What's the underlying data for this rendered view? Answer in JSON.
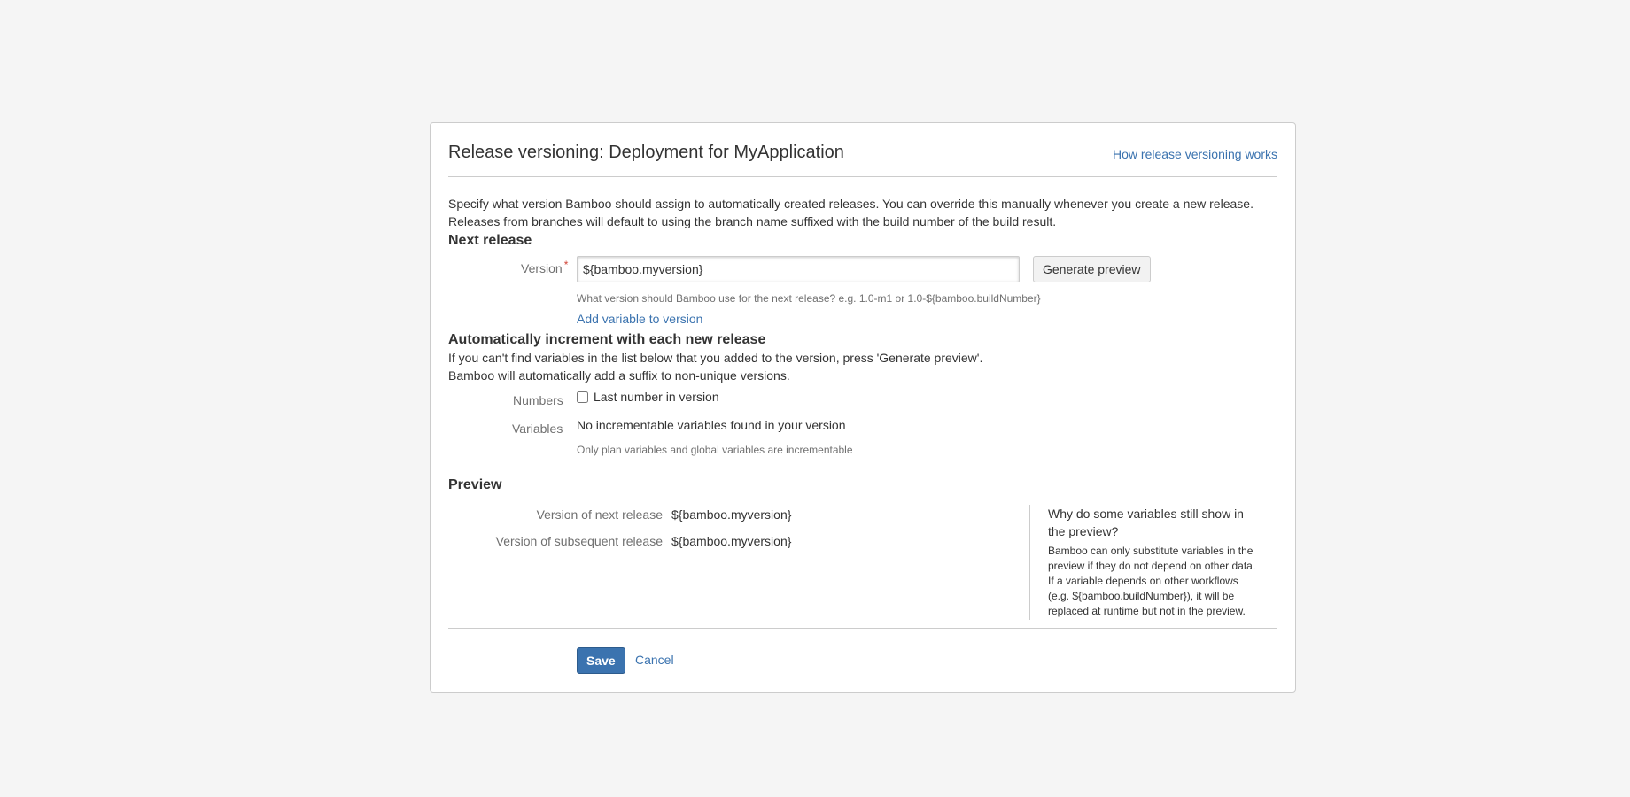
{
  "dialog": {
    "title": "Release versioning: Deployment for MyApplication",
    "help_link": "How release versioning works",
    "intro_line1": "Specify what version Bamboo should assign to automatically created releases. You can override this manually whenever you create a new release.",
    "intro_line2": "Releases from branches will default to using the branch name suffixed with the build number of the build result."
  },
  "next_release": {
    "heading": "Next release",
    "version_label": "Version",
    "required_marker": "*",
    "version_value": "${bamboo.myversion}",
    "generate_preview_label": "Generate preview",
    "version_hint": "What version should Bamboo use for the next release? e.g. 1.0-m1 or 1.0-${bamboo.buildNumber}",
    "add_variable_link": "Add variable to version"
  },
  "auto_increment": {
    "heading": "Automatically increment with each new release",
    "desc_line1": "If you can't find variables in the list below that you added to the version, press 'Generate preview'.",
    "desc_line2": "Bamboo will automatically add a suffix to non-unique versions.",
    "numbers_label": "Numbers",
    "last_number_label": "Last number in version",
    "last_number_checked": false,
    "variables_label": "Variables",
    "variables_value": "No incrementable variables found in your version",
    "variables_hint": "Only plan variables and global variables are incrementable"
  },
  "preview": {
    "heading": "Preview",
    "next_label": "Version of next release",
    "next_value": "${bamboo.myversion}",
    "subsequent_label": "Version of subsequent release",
    "subsequent_value": "${bamboo.myversion}",
    "aside_title": "Why do some variables still show in the preview?",
    "aside_body": "Bamboo can only substitute variables in the preview if they do not depend on other data. If a variable depends on other workflows (e.g. ${bamboo.buildNumber}), it will be replaced at runtime but not in the preview."
  },
  "footer": {
    "save_label": "Save",
    "cancel_label": "Cancel"
  },
  "colors": {
    "background": "#f5f5f5",
    "link": "#3b73af",
    "primary_button": "#3b73af",
    "required": "#d04437"
  }
}
